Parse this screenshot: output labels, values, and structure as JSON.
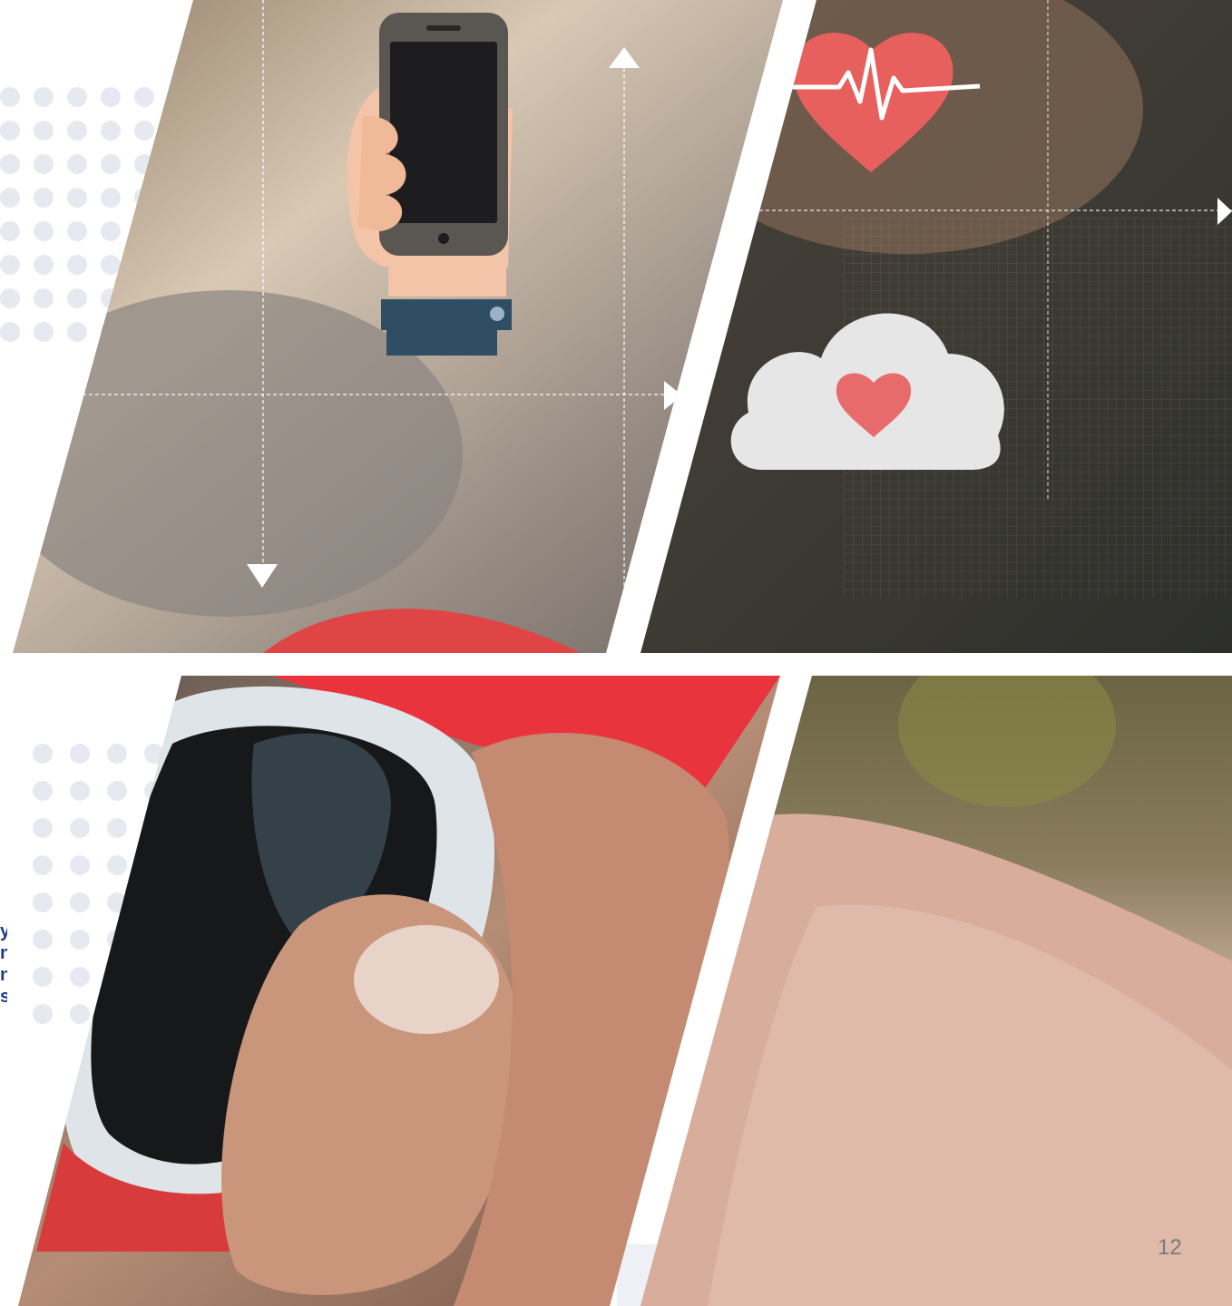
{
  "slide": {
    "page_number": "12",
    "edge_glyphs": [
      "y",
      "n",
      "n",
      "s"
    ]
  },
  "colors": {
    "background": "#ffffff",
    "dots": "#e6e9ef",
    "accent_red": "#e63a45",
    "edge_text": "#1e3a8a"
  },
  "icons": [
    "smartphone-icon",
    "heartbeat-icon",
    "cloud-heart-icon",
    "arrow-up-icon",
    "arrow-down-icon",
    "arrow-right-icon"
  ]
}
